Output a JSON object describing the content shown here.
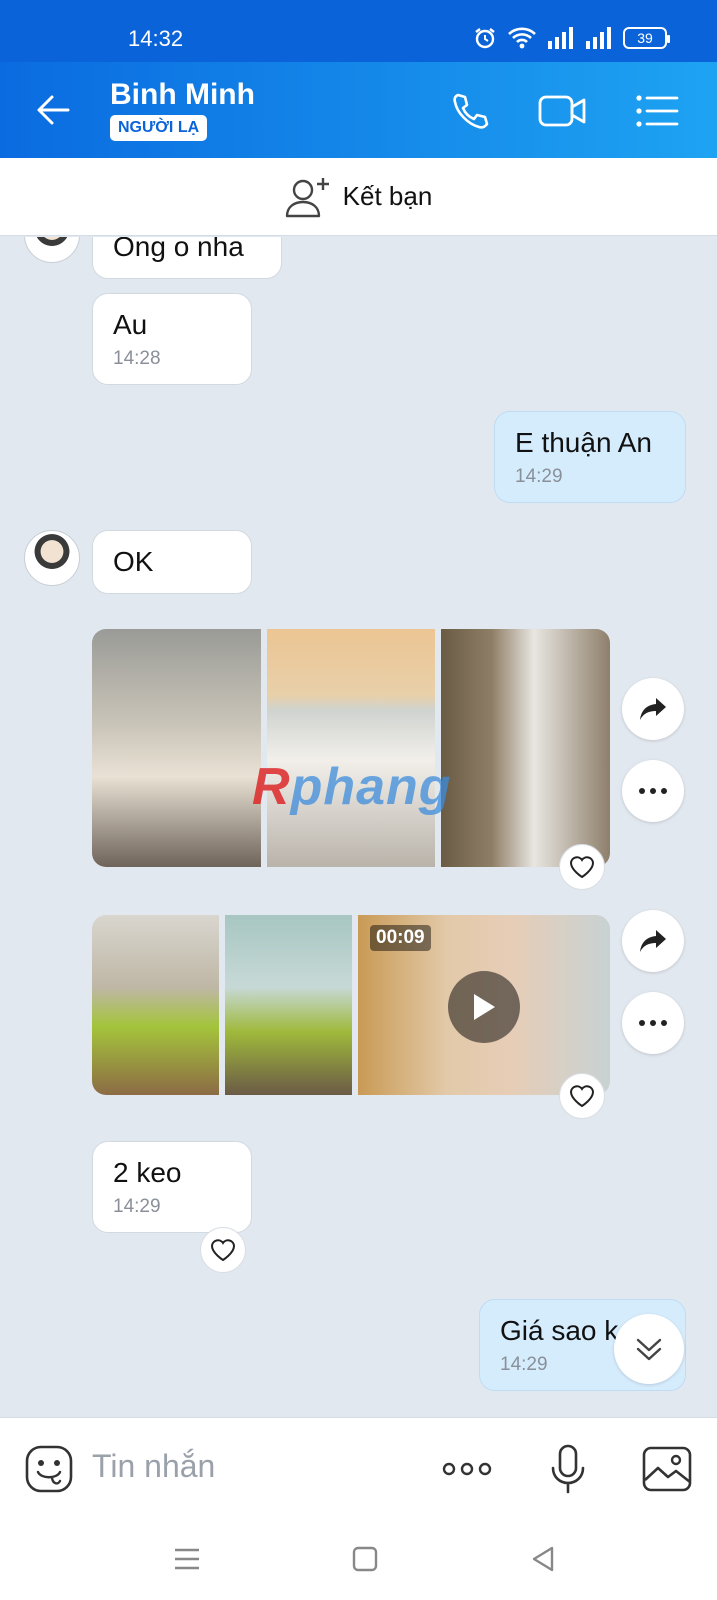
{
  "status_bar": {
    "time": "14:32",
    "battery": "39"
  },
  "header": {
    "contact_name": "Binh Minh",
    "badge": "NGƯỜI LẠ"
  },
  "add_friend": {
    "label": "Kết bạn"
  },
  "messages": {
    "m1": {
      "text": "Ong o nha"
    },
    "m2": {
      "text": "Au",
      "time": "14:28"
    },
    "m3": {
      "text": "E thuận An",
      "time": "14:29"
    },
    "m4": {
      "text": "OK"
    },
    "video": {
      "duration": "00:09"
    },
    "m5": {
      "text": "2 keo",
      "time": "14:29"
    },
    "m6": {
      "text": "Giá sao k",
      "time": "14:29"
    }
  },
  "watermark": {
    "part1": "R",
    "part2": "phang"
  },
  "input": {
    "placeholder": "Tin nhắn"
  },
  "colors": {
    "header_start": "#0a6be0",
    "header_end": "#1ea3f2",
    "chat_bg": "#e2e8ef",
    "my_bubble": "#d5ecfd"
  }
}
